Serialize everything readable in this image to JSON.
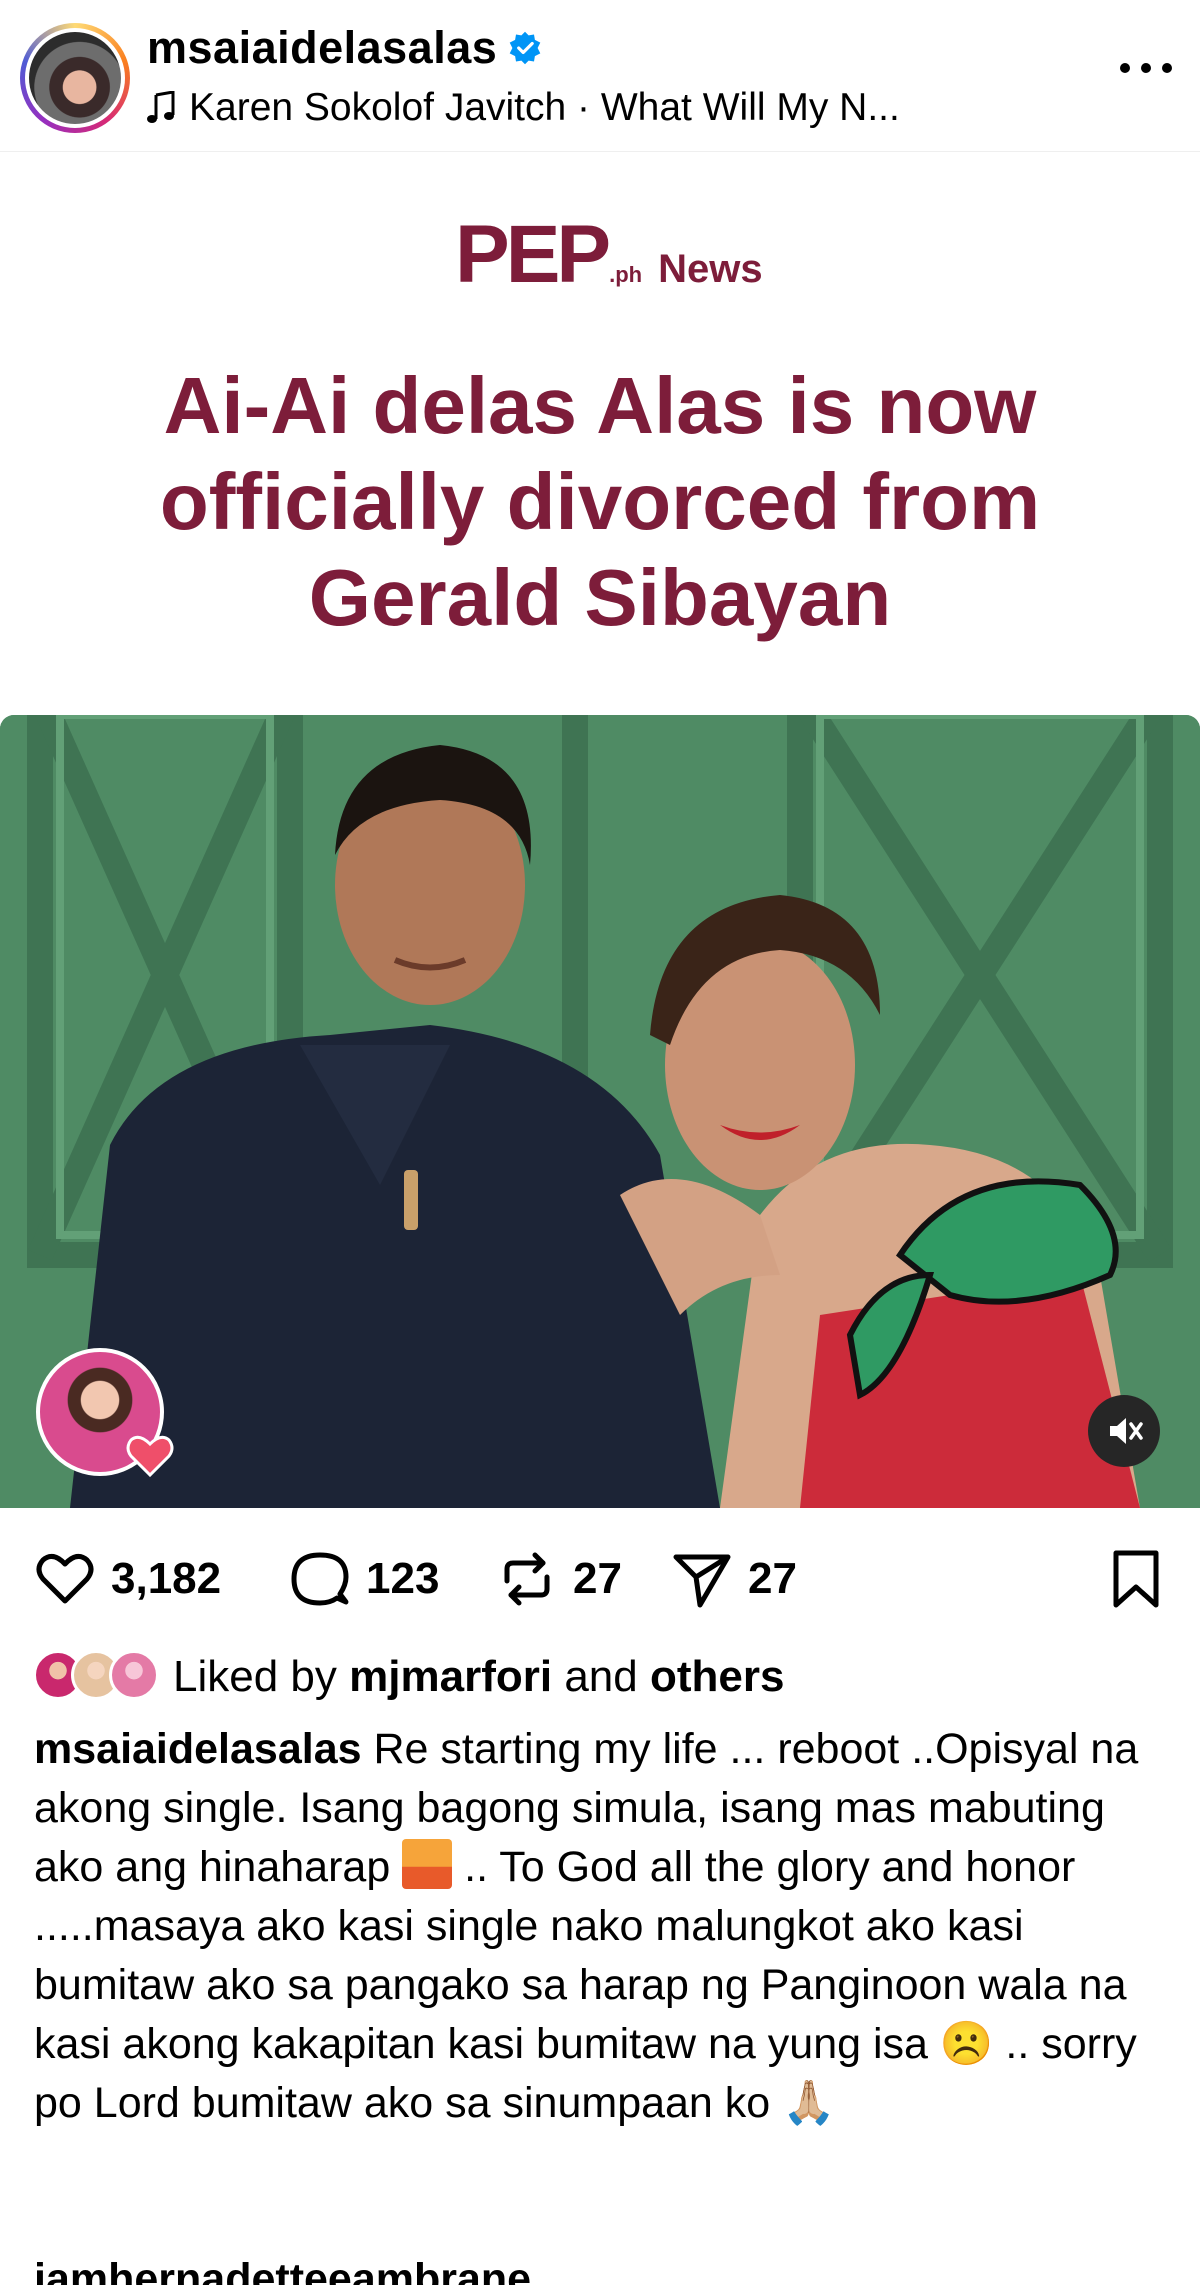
{
  "post": {
    "username": "msaiaidelasalas",
    "music": "Karen Sokolof Javitch · What Will My N...",
    "more_icon": "more-horizontal-icon"
  },
  "media": {
    "logo_main": "PEP",
    "logo_suffix": ".ph",
    "logo_section": "News",
    "headline": "Ai-Ai delas Alas is now officially divorced from Gerald Sibayan",
    "background_color": "#4e8a63",
    "headline_color": "#7d1d3a"
  },
  "actions": {
    "likes_count": "3,182",
    "comments_count": "123",
    "reposts_count": "27",
    "shares_count": "27"
  },
  "likes": {
    "prefix": "Liked by",
    "user": "mjmarfori",
    "middle": "and",
    "others": "others"
  },
  "caption": {
    "username": "msaiaidelasalas",
    "text_part1": "Re starting my life ... reboot ..Opisyal na akong single. Isang bagong simula, isang mas mabuting ako ang hinaharap",
    "text_part2": ".. To God all the glory and honor .....masaya ako kasi single nako malungkot ako kasi bumitaw ako sa pangako sa harap ng Panginoon wala na kasi akong kakapitan kasi bumitaw na yung isa",
    "emoji_sad": "☹️",
    "text_part3": ".. sorry po Lord bumitaw ako sa sinumpaan ko",
    "emoji_pray": "🙏🏼"
  },
  "next_comment": {
    "username": "iamhernadetteeambrane"
  }
}
